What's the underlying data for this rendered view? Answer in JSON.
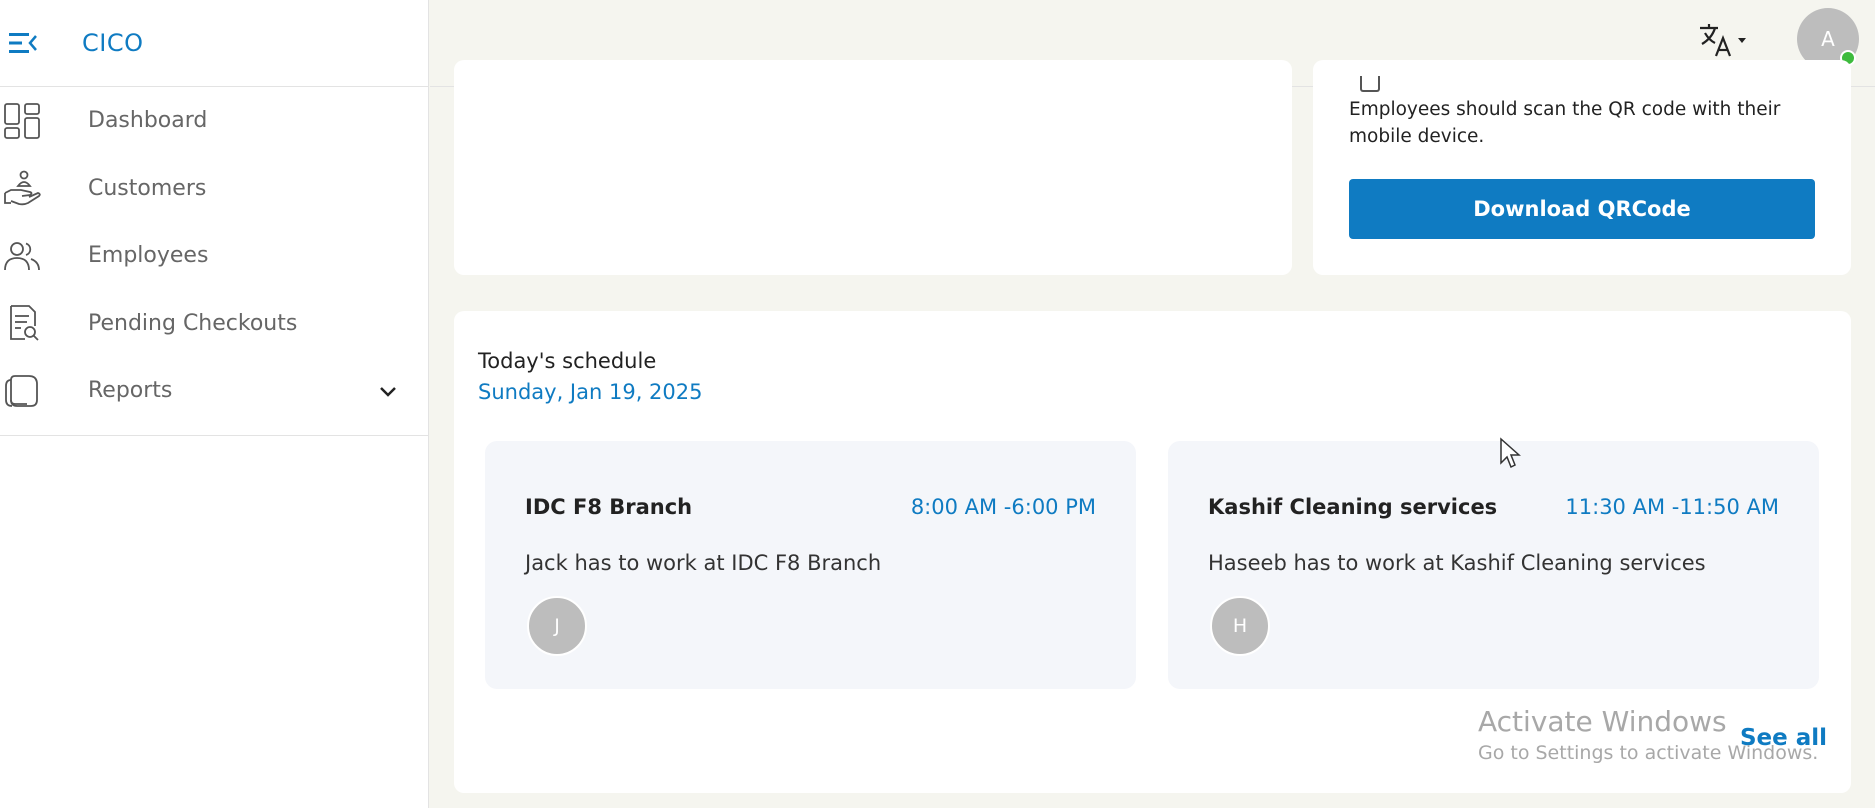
{
  "app": {
    "brand": "CICO"
  },
  "sidebar": {
    "items": [
      {
        "label": "Dashboard",
        "icon": "dashboard-icon"
      },
      {
        "label": "Customers",
        "icon": "customers-icon"
      },
      {
        "label": "Employees",
        "icon": "employees-icon"
      },
      {
        "label": "Pending Checkouts",
        "icon": "pending-checkouts-icon"
      },
      {
        "label": "Reports",
        "icon": "reports-icon"
      }
    ]
  },
  "topbar": {
    "language_icon": "translate-icon",
    "avatar_initial": "A"
  },
  "qr": {
    "instruction": "Employees should scan the QR code with their mobile device.",
    "download_label": "Download QRCode"
  },
  "schedule": {
    "title": "Today's schedule",
    "date": "Sunday, Jan 19, 2025",
    "shifts": [
      {
        "location": "IDC F8 Branch",
        "time": "8:00 AM -6:00 PM",
        "description": "Jack has to work at IDC F8 Branch",
        "avatar_initial": "J"
      },
      {
        "location": "Kashif Cleaning services",
        "time": "11:30 AM -11:50 AM",
        "description": "Haseeb has to work at Kashif Cleaning services",
        "avatar_initial": "H"
      }
    ],
    "see_all_label": "See all"
  },
  "watermark": {
    "title": "Activate Windows",
    "subtitle": "Go to Settings to activate Windows."
  },
  "colors": {
    "accent": "#0f7bc2",
    "background": "#f5f5ef",
    "online": "#3dbb3d"
  }
}
